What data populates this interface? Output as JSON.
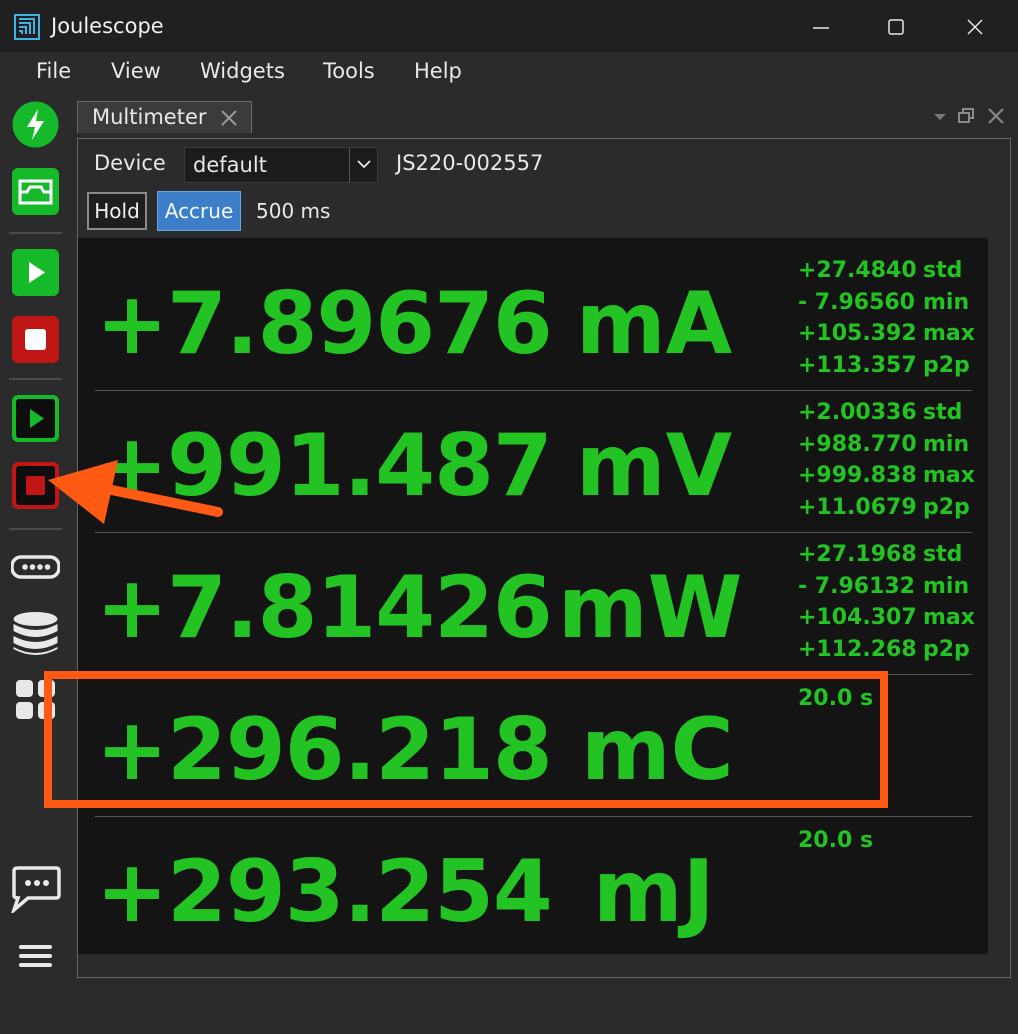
{
  "window": {
    "title": "Joulescope"
  },
  "menu": [
    "File",
    "View",
    "Widgets",
    "Tools",
    "Help"
  ],
  "dock": {
    "tab_label": "Multimeter"
  },
  "device": {
    "label": "Device",
    "selected": "default",
    "serial": "JS220-002557"
  },
  "controls": {
    "hold_label": "Hold",
    "accrue_label": "Accrue",
    "interval": "500 ms"
  },
  "rows": [
    {
      "value": "+7.89676",
      "unit": "mA",
      "stats": [
        {
          "value": "+27.4840",
          "name": "std"
        },
        {
          "value": "- 7.96560",
          "name": "min"
        },
        {
          "value": "+105.392",
          "name": "max"
        },
        {
          "value": "+113.357",
          "name": "p2p"
        }
      ]
    },
    {
      "value": "+991.487",
      "unit": "mV",
      "stats": [
        {
          "value": "+2.00336",
          "name": "std"
        },
        {
          "value": "+988.770",
          "name": "min"
        },
        {
          "value": "+999.838",
          "name": "max"
        },
        {
          "value": "+11.0679",
          "name": "p2p"
        }
      ]
    },
    {
      "value": "+7.81426",
      "unit": "mW",
      "stats": [
        {
          "value": "+27.1968",
          "name": "std"
        },
        {
          "value": "- 7.96132",
          "name": "min"
        },
        {
          "value": "+104.307",
          "name": "max"
        },
        {
          "value": "+112.268",
          "name": "p2p"
        }
      ]
    },
    {
      "value": "+296.218",
      "unit": "mC",
      "duration": "20.0 s"
    },
    {
      "value": "+293.254",
      "unit": "mJ",
      "duration": "20.0 s"
    }
  ],
  "colors": {
    "reading": "#22c322",
    "highlight": "#ff5a14",
    "accrue_active": "#3d7ec9"
  },
  "sidebar_icons": [
    "lightning-icon",
    "sensor-icon",
    "play-icon",
    "stop-icon",
    "record-play-icon",
    "record-stop-icon",
    "device-icon",
    "database-icon",
    "widgets-icon",
    "chat-icon",
    "menu-icon"
  ]
}
